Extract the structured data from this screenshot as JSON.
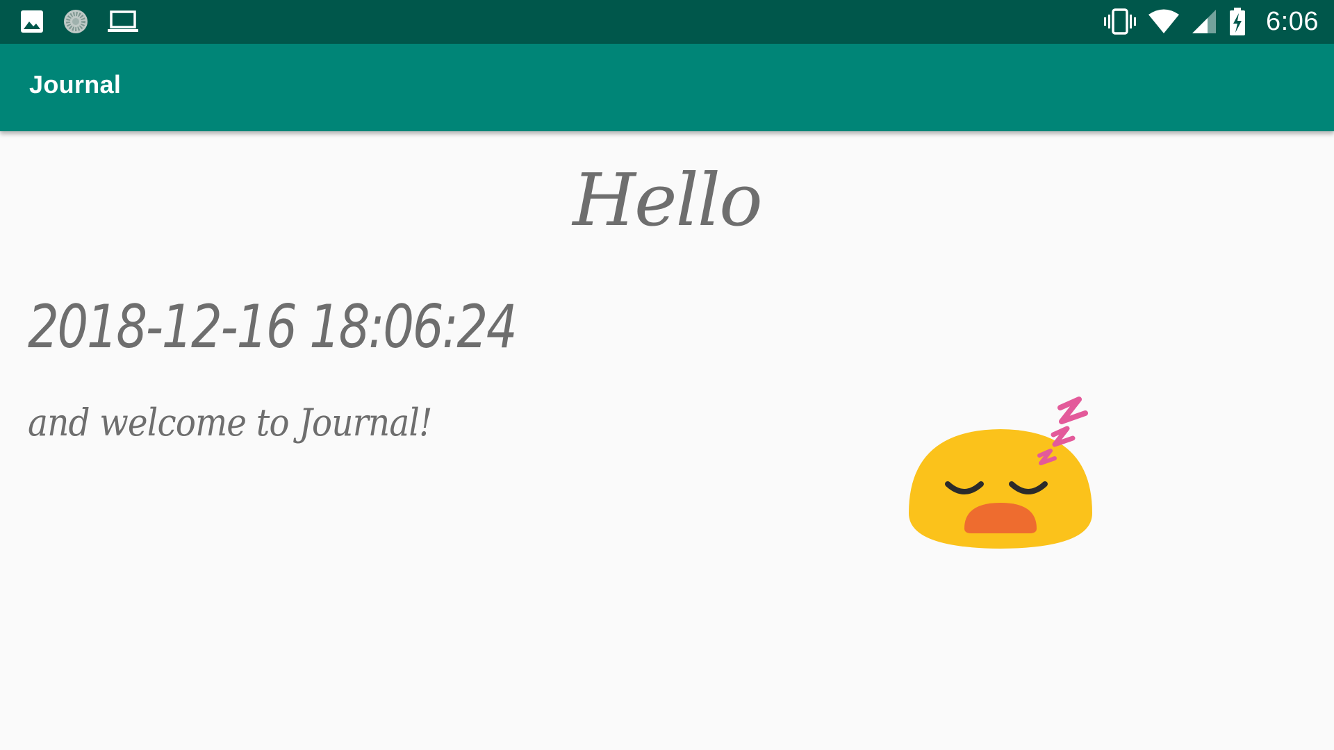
{
  "status_bar": {
    "time": "6:06",
    "left_icons": [
      "image-icon",
      "sync-icon",
      "laptop-icon"
    ],
    "right_icons": [
      "vibrate-icon",
      "wifi-icon",
      "signal-icon",
      "battery-charging-icon"
    ]
  },
  "app_bar": {
    "title": "Journal"
  },
  "main": {
    "greeting": "Hello",
    "datetime": "2018-12-16 18:06:24",
    "welcome": "and welcome to Journal!",
    "mood_icon": "sleeping-face-icon"
  },
  "colors": {
    "status_bar": "#00574b",
    "app_bar": "#008577",
    "background": "#fafafa",
    "text": "#6e6e6e",
    "emoji_face": "#fbc21b",
    "emoji_mouth": "#ee6c2f",
    "emoji_zzz": "#e35a9a"
  }
}
